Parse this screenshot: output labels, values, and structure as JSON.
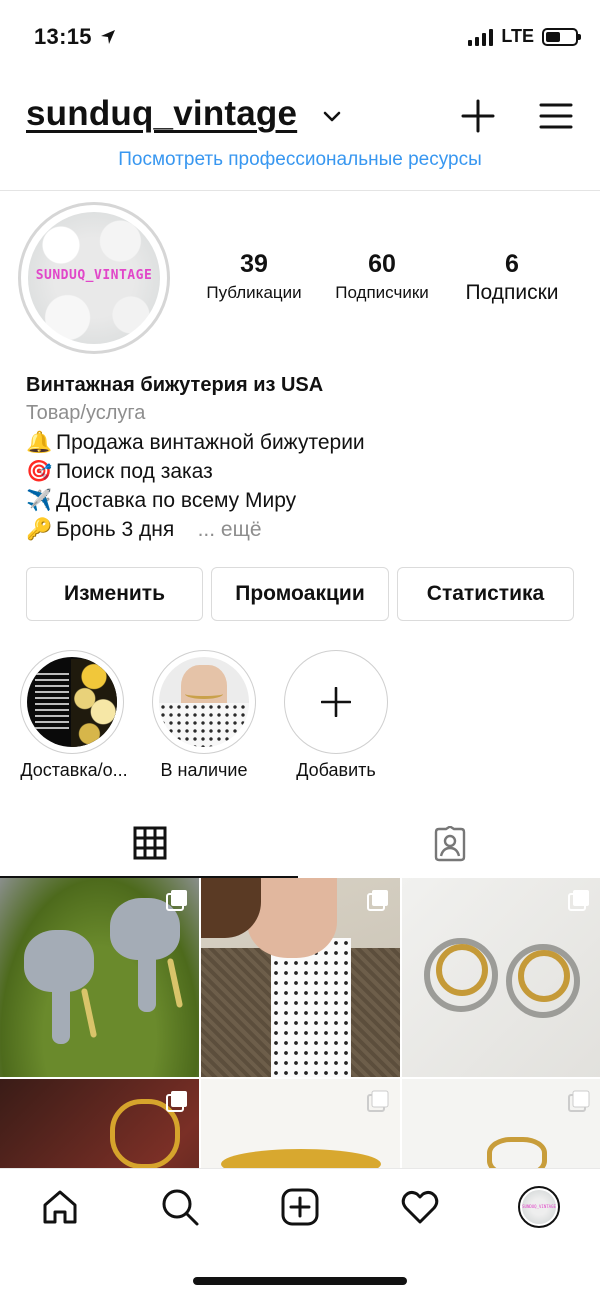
{
  "status_bar": {
    "time": "13:15",
    "network": "LTE"
  },
  "header": {
    "username": "sunduq_vintage"
  },
  "pro_link": "Посмотреть профессиональные ресурсы",
  "profile": {
    "avatar_text": "SUNDUQ_VINTAGE",
    "stats": [
      {
        "value": "39",
        "label": "Публикации"
      },
      {
        "value": "60",
        "label": "Подписчики"
      },
      {
        "value": "6",
        "label": "Подписки"
      }
    ],
    "bio": {
      "name": "Винтажная бижутерия из USA",
      "category": "Товар/услуга",
      "lines": [
        {
          "emoji": "🔔",
          "text": "Продажа винтажной бижутерии"
        },
        {
          "emoji": "🎯",
          "text": "Поиск под заказ"
        },
        {
          "emoji": "✈️",
          "text": "Доставка по всему Миру"
        },
        {
          "emoji": "🔑",
          "text": "Бронь 3 дня"
        }
      ],
      "more": "... ещё"
    }
  },
  "buttons": {
    "edit": "Изменить",
    "promo": "Промоакции",
    "stats": "Статистика"
  },
  "highlights": [
    {
      "label": "Доставка/о..."
    },
    {
      "label": "В наличие"
    },
    {
      "label": "Добавить"
    }
  ],
  "icons": {
    "header_chevron": "chevron-down-icon",
    "header_new_post": "plus-icon",
    "header_menu": "menu-icon",
    "tab_grid": "grid-icon",
    "tab_tagged": "tagged-icon",
    "nav": [
      "home-icon",
      "search-icon",
      "new-post-icon",
      "heart-icon",
      "profile-avatar"
    ]
  },
  "colors": {
    "link": "#3897f0",
    "secondary_text": "#8e8e8e",
    "avatar_text": "#e146c9"
  }
}
